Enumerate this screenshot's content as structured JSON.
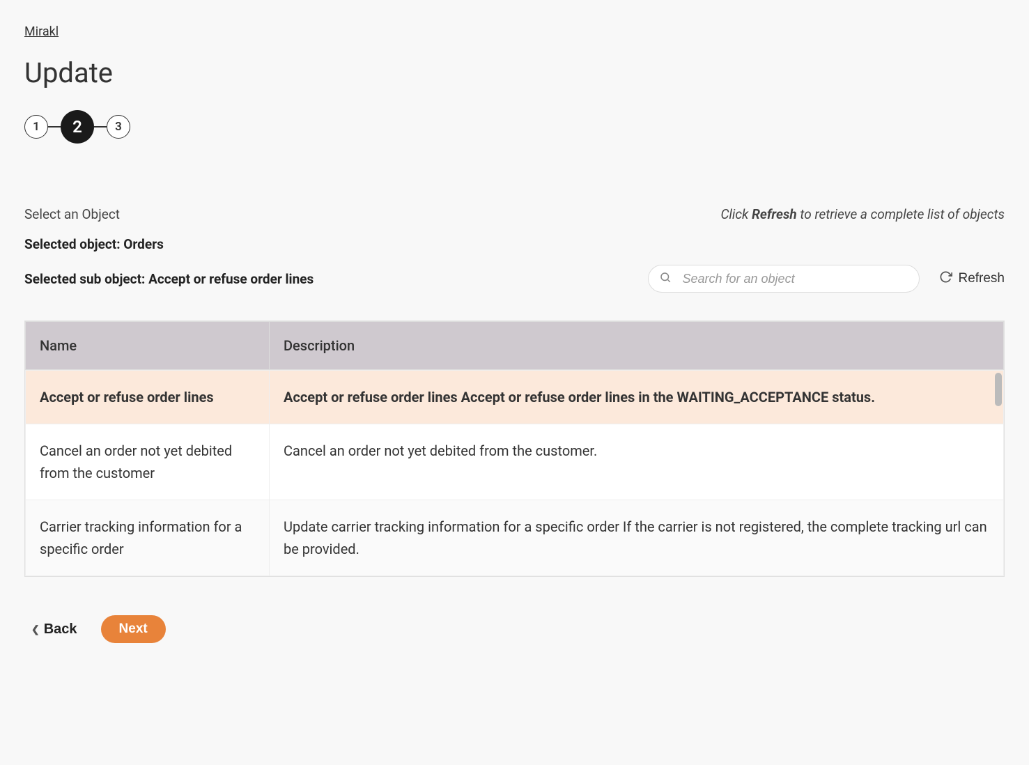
{
  "breadcrumb": "Mirakl",
  "page_title": "Update",
  "stepper": {
    "steps": [
      "1",
      "2",
      "3"
    ],
    "active": 1
  },
  "select_label": "Select an Object",
  "hint_prefix": "Click ",
  "hint_bold": "Refresh",
  "hint_suffix": " to retrieve a complete list of objects",
  "selected_object_label": "Selected object: Orders",
  "selected_sub_object_label": "Selected sub object: Accept or refuse order lines",
  "search": {
    "placeholder": "Search for an object"
  },
  "refresh_label": "Refresh",
  "table": {
    "headers": {
      "name": "Name",
      "description": "Description"
    },
    "rows": [
      {
        "name": "Accept or refuse order lines",
        "description": "Accept or refuse order lines Accept or refuse order lines in the WAITING_ACCEPTANCE status.",
        "selected": true
      },
      {
        "name": "Cancel an order not yet debited from the customer",
        "description": "Cancel an order not yet debited from the customer.",
        "selected": false
      },
      {
        "name": "Carrier tracking information for a specific order",
        "description": "Update carrier tracking information for a specific order If the carrier is not registered, the complete tracking url can be provided.",
        "selected": false
      }
    ]
  },
  "footer": {
    "back": "Back",
    "next": "Next"
  }
}
